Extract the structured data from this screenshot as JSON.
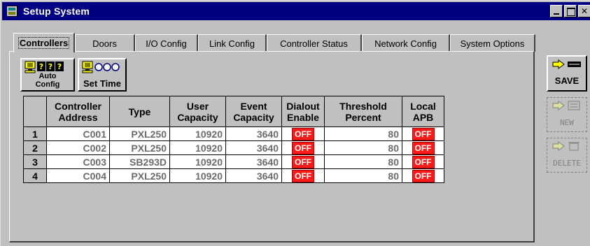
{
  "window": {
    "title": "Setup System"
  },
  "tabs": [
    {
      "label": "Controllers",
      "active": true
    },
    {
      "label": "Doors"
    },
    {
      "label": "I/O Config"
    },
    {
      "label": "Link Config"
    },
    {
      "label": "Controller Status"
    },
    {
      "label": "Network Config"
    },
    {
      "label": "System Options"
    }
  ],
  "toolbar": {
    "auto_config": {
      "line1": "Auto",
      "line2": "Config",
      "icon": "pc-question-icon"
    },
    "set_time": {
      "label": "Set Time",
      "icon": "pc-clock-icon"
    }
  },
  "grid": {
    "headers": [
      "Controller Address",
      "Type",
      "User Capacity",
      "Event Capacity",
      "Dialout Enable",
      "Threshold Percent",
      "Local APB"
    ],
    "rows": [
      {
        "num": "1",
        "address": "C001",
        "type": "PXL250",
        "user_capacity": "10920",
        "event_capacity": "3640",
        "dialout": "OFF",
        "threshold": "80",
        "apb": "OFF"
      },
      {
        "num": "2",
        "address": "C002",
        "type": "PXL250",
        "user_capacity": "10920",
        "event_capacity": "3640",
        "dialout": "OFF",
        "threshold": "80",
        "apb": "OFF"
      },
      {
        "num": "3",
        "address": "C003",
        "type": "SB293D",
        "user_capacity": "10920",
        "event_capacity": "3640",
        "dialout": "OFF",
        "threshold": "80",
        "apb": "OFF"
      },
      {
        "num": "4",
        "address": "C004",
        "type": "PXL250",
        "user_capacity": "10920",
        "event_capacity": "3640",
        "dialout": "OFF",
        "threshold": "80",
        "apb": "OFF"
      }
    ]
  },
  "side_buttons": {
    "save": {
      "label": "SAVE",
      "icon": "arrow-bar-icon"
    },
    "new": {
      "label": "NEW",
      "icon": "arrow-form-icon"
    },
    "delete": {
      "label": "DELETE",
      "icon": "arrow-trash-icon"
    }
  },
  "colors": {
    "title_bar": "#000080",
    "off_badge": "#ff1a1a",
    "window": "#c0c0c0"
  }
}
